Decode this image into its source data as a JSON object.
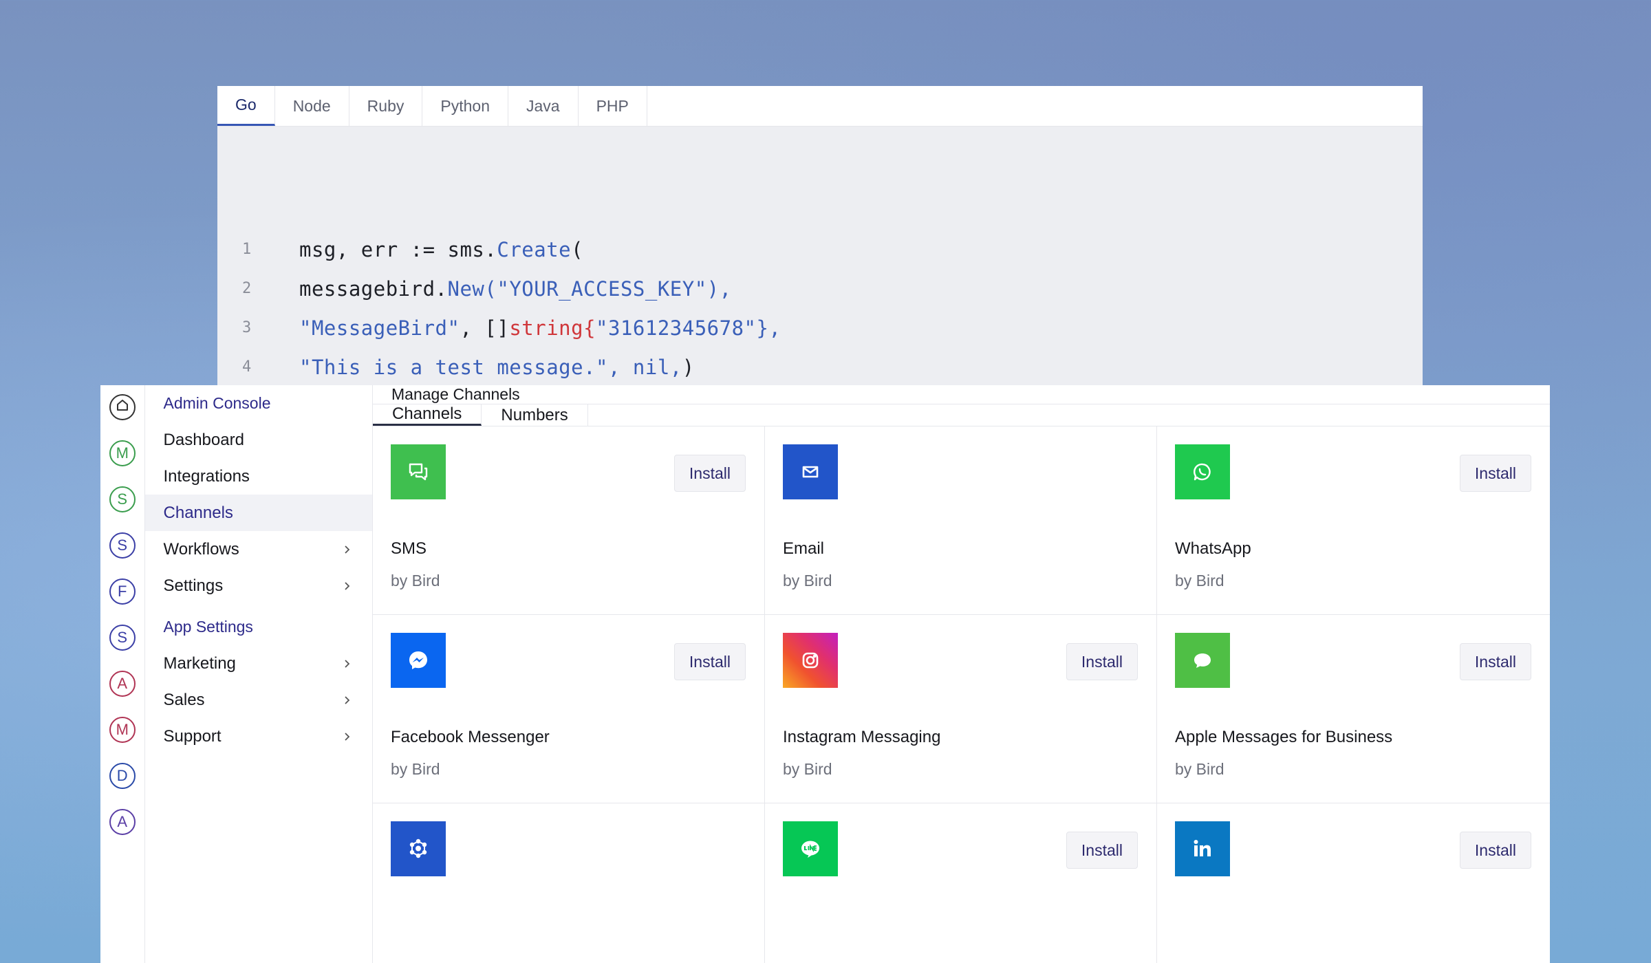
{
  "code_panel": {
    "tabs": [
      "Go",
      "Node",
      "Ruby",
      "Python",
      "Java",
      "PHP"
    ],
    "active_tab": "Go",
    "lines": [
      {
        "num": "1",
        "segments": [
          {
            "t": "msg, err := sms.",
            "c": "dark"
          },
          {
            "t": "Create",
            "c": "blue"
          },
          {
            "t": "(",
            "c": "dark"
          }
        ]
      },
      {
        "num": "2",
        "segments": [
          {
            "t": "messagebird.",
            "c": "dark"
          },
          {
            "t": "New",
            "c": "blue"
          },
          {
            "t": "(\"YOUR_ACCESS_KEY\"),",
            "c": "blue"
          }
        ]
      },
      {
        "num": "3",
        "segments": [
          {
            "t": "\"MessageBird\"",
            "c": "blue"
          },
          {
            "t": ", []",
            "c": "dark"
          },
          {
            "t": "string{",
            "c": "red"
          },
          {
            "t": "\"31612345678\"},",
            "c": "blue"
          }
        ]
      },
      {
        "num": "4",
        "segments": [
          {
            "t": "\"This is a test message.\", nil,",
            "c": "blue"
          },
          {
            "t": ")",
            "c": "dark"
          }
        ]
      }
    ]
  },
  "rail": {
    "items": [
      {
        "label": "",
        "icon": "home-icon",
        "color": "#333333"
      },
      {
        "label": "M",
        "color": "#3a9d4d"
      },
      {
        "label": "S",
        "color": "#3a9d4d"
      },
      {
        "label": "S",
        "color": "#3b3fa6"
      },
      {
        "label": "F",
        "color": "#3b3fa6"
      },
      {
        "label": "S",
        "color": "#3b3fa6"
      },
      {
        "label": "A",
        "color": "#b03454"
      },
      {
        "label": "M",
        "color": "#b03454"
      },
      {
        "label": "D",
        "color": "#2a4aa8"
      },
      {
        "label": "A",
        "color": "#5b3fa6"
      }
    ]
  },
  "sidenav": {
    "section1": "Admin Console",
    "items1": [
      {
        "label": "Dashboard",
        "chevron": false
      },
      {
        "label": "Integrations",
        "chevron": false
      },
      {
        "label": "Channels",
        "chevron": false,
        "active": true
      },
      {
        "label": "Workflows",
        "chevron": true
      },
      {
        "label": "Settings",
        "chevron": true
      }
    ],
    "section2": "App Settings",
    "items2": [
      {
        "label": "Marketing",
        "chevron": true
      },
      {
        "label": "Sales",
        "chevron": true
      },
      {
        "label": "Support",
        "chevron": true
      }
    ]
  },
  "main": {
    "title": "Manage Channels",
    "tabs": [
      "Channels",
      "Numbers"
    ],
    "active_tab": "Channels",
    "install_label": "Install",
    "channels": [
      {
        "name": "SMS",
        "by": "by Bird",
        "icon": "sms-icon",
        "bg": "#3fbf4f",
        "install": true
      },
      {
        "name": "Email",
        "by": "by Bird",
        "icon": "email-icon",
        "bg": "#2255c9",
        "install": false
      },
      {
        "name": "WhatsApp",
        "by": "by Bird",
        "icon": "whatsapp-icon",
        "bg": "#1fc94f",
        "install": true
      },
      {
        "name": "Facebook Messenger",
        "by": "by Bird",
        "icon": "messenger-icon",
        "bg": "#0a66f0",
        "install": true
      },
      {
        "name": "Instagram Messaging",
        "by": "by Bird",
        "icon": "instagram-icon",
        "bg": "#e1306c",
        "install": true
      },
      {
        "name": "Apple Messages for Business",
        "by": "by Bird",
        "icon": "apple-messages-icon",
        "bg": "#4fbf45",
        "install": true
      },
      {
        "name": "",
        "by": "",
        "icon": "cube-network-icon",
        "bg": "#2255c9",
        "install": false
      },
      {
        "name": "",
        "by": "",
        "icon": "line-icon",
        "bg": "#06c755",
        "install": true
      },
      {
        "name": "",
        "by": "",
        "icon": "linkedin-icon",
        "bg": "#0a78c2",
        "install": true
      }
    ]
  }
}
